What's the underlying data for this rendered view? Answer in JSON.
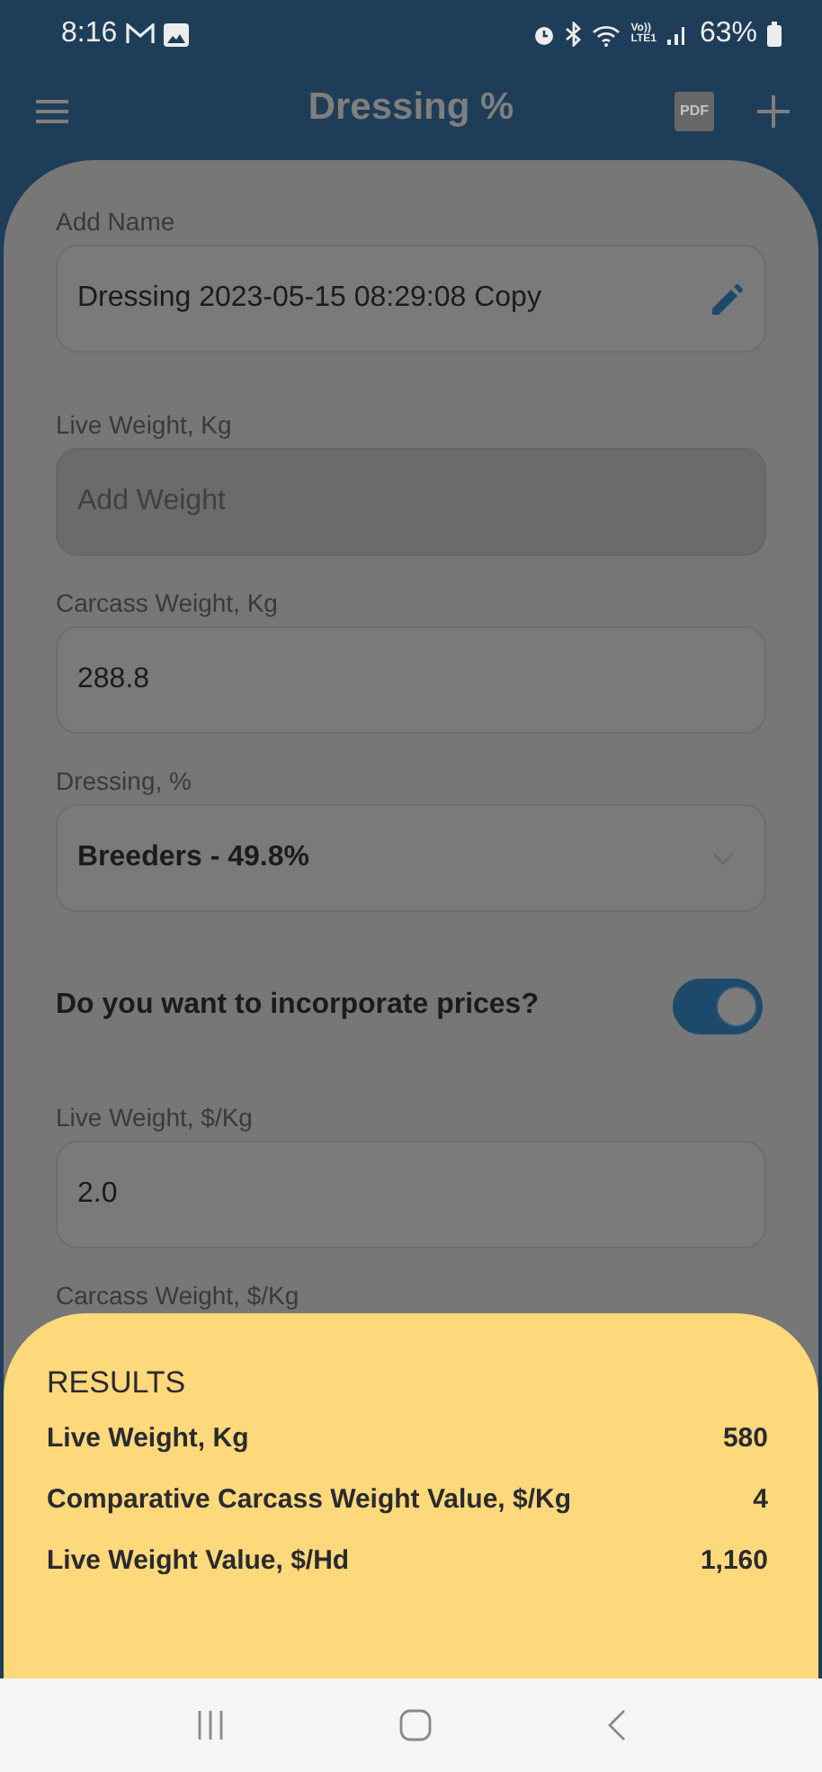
{
  "status_bar": {
    "time": "8:16",
    "network_label": [
      "Vo))",
      "LTE1"
    ],
    "battery": "63%"
  },
  "app_bar": {
    "title": "Dressing %",
    "pdf_label": "PDF"
  },
  "form": {
    "fields": [
      {
        "kind": "editable",
        "label": "Add Name",
        "value": "Dressing 2023-05-15 08:29:08 Copy",
        "disabled": false
      },
      {
        "kind": "text",
        "label": "Live Weight, Kg",
        "placeholder": "Add Weight",
        "disabled": true
      },
      {
        "kind": "text",
        "label": "Carcass Weight, Kg",
        "value": "288.8",
        "disabled": false
      },
      {
        "kind": "select",
        "label": "Dressing, %",
        "value": "Breeders - 49.8%",
        "disabled": false
      },
      {
        "kind": "toggle",
        "label": "Do you want to incorporate prices?",
        "on": true
      },
      {
        "kind": "text",
        "label": "Live Weight, $/Kg",
        "value": "2.0",
        "disabled": false
      },
      {
        "kind": "label",
        "label": "Carcass Weight, $/Kg"
      }
    ]
  },
  "results": {
    "title": "RESULTS",
    "rows": [
      {
        "label": "Live Weight, Kg",
        "value": "580"
      },
      {
        "label": "Comparative Carcass Weight Value, $/Kg",
        "value": "4"
      },
      {
        "label": "Live Weight Value, $/Hd",
        "value": "1,160"
      }
    ]
  }
}
